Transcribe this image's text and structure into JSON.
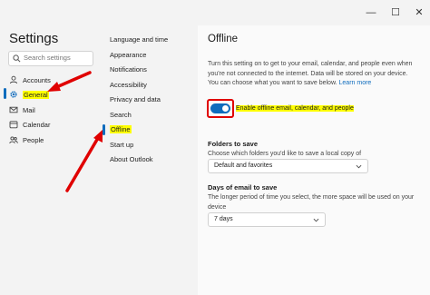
{
  "window": {
    "minimize_glyph": "—",
    "maximize_glyph": "☐",
    "close_glyph": "✕"
  },
  "sidebar": {
    "title": "Settings",
    "search_placeholder": "Search settings",
    "items": [
      {
        "label": "Accounts",
        "icon": "person-icon"
      },
      {
        "label": "General",
        "icon": "gear-icon",
        "selected": true,
        "highlighted": true
      },
      {
        "label": "Mail",
        "icon": "mail-icon"
      },
      {
        "label": "Calendar",
        "icon": "calendar-icon"
      },
      {
        "label": "People",
        "icon": "people-icon"
      }
    ]
  },
  "subnav": {
    "items": [
      {
        "label": "Language and time"
      },
      {
        "label": "Appearance"
      },
      {
        "label": "Notifications"
      },
      {
        "label": "Accessibility"
      },
      {
        "label": "Privacy and data"
      },
      {
        "label": "Search"
      },
      {
        "label": "Offline",
        "selected": true,
        "highlighted": true
      },
      {
        "label": "Start up"
      },
      {
        "label": "About Outlook"
      }
    ]
  },
  "panel": {
    "title": "Offline",
    "description": "Turn this setting on to get to your email, calendar, and people even when you're not connected to the internet. Data will be stored on your device. You can choose what you want to save below.",
    "learn_more": "Learn more",
    "toggle": {
      "label": "Enable offline email, calendar, and people",
      "on": true
    },
    "folders": {
      "heading": "Folders to save",
      "description": "Choose which folders you'd like to save a local copy of",
      "selected": "Default and favorites"
    },
    "days": {
      "heading": "Days of email to save",
      "description": "The longer period of time you select, the more space will be used on your device",
      "selected": "7 days"
    }
  },
  "colors": {
    "accent": "#0f6cbd",
    "highlight": "#ffff00",
    "annotation": "#e00000"
  }
}
